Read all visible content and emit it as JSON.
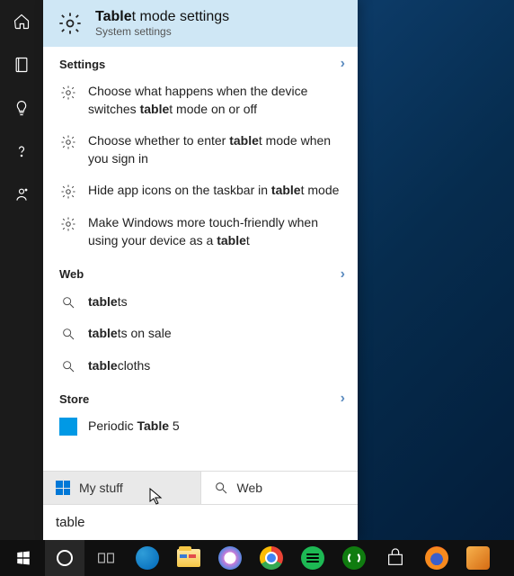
{
  "best_match": {
    "title_prefix": "Table",
    "title_suffix": "t mode settings",
    "subtitle": "System settings"
  },
  "sections": {
    "settings": {
      "label": "Settings",
      "items": [
        {
          "prefix": "Choose what happens when the device switches ",
          "bold": "table",
          "suffix": "t mode on or off"
        },
        {
          "prefix": "Choose whether to enter ",
          "bold": "table",
          "suffix": "t mode when you sign in"
        },
        {
          "prefix": "Hide app icons on the taskbar in ",
          "bold": "table",
          "suffix": "t mode"
        },
        {
          "prefix": "Make Windows more touch-friendly when using your device as a ",
          "bold": "table",
          "suffix": "t"
        }
      ]
    },
    "web": {
      "label": "Web",
      "items": [
        {
          "bold": "table",
          "suffix": "ts"
        },
        {
          "bold": "table",
          "suffix": "ts on sale"
        },
        {
          "bold": "table",
          "suffix": "cloths"
        }
      ]
    },
    "store": {
      "label": "Store",
      "items": [
        {
          "prefix": "Periodic ",
          "bold": "Table",
          "suffix": " 5"
        }
      ]
    }
  },
  "filters": {
    "my_stuff": "My stuff",
    "web": "Web"
  },
  "search": {
    "value": "table"
  },
  "rail_icons": [
    "home",
    "notebook",
    "lightbulb",
    "help",
    "feedback"
  ],
  "taskbar": [
    "start",
    "cortana",
    "taskview",
    "edge",
    "explorer",
    "itunes",
    "chrome",
    "spotify",
    "xbox",
    "store",
    "firefox",
    "app"
  ]
}
